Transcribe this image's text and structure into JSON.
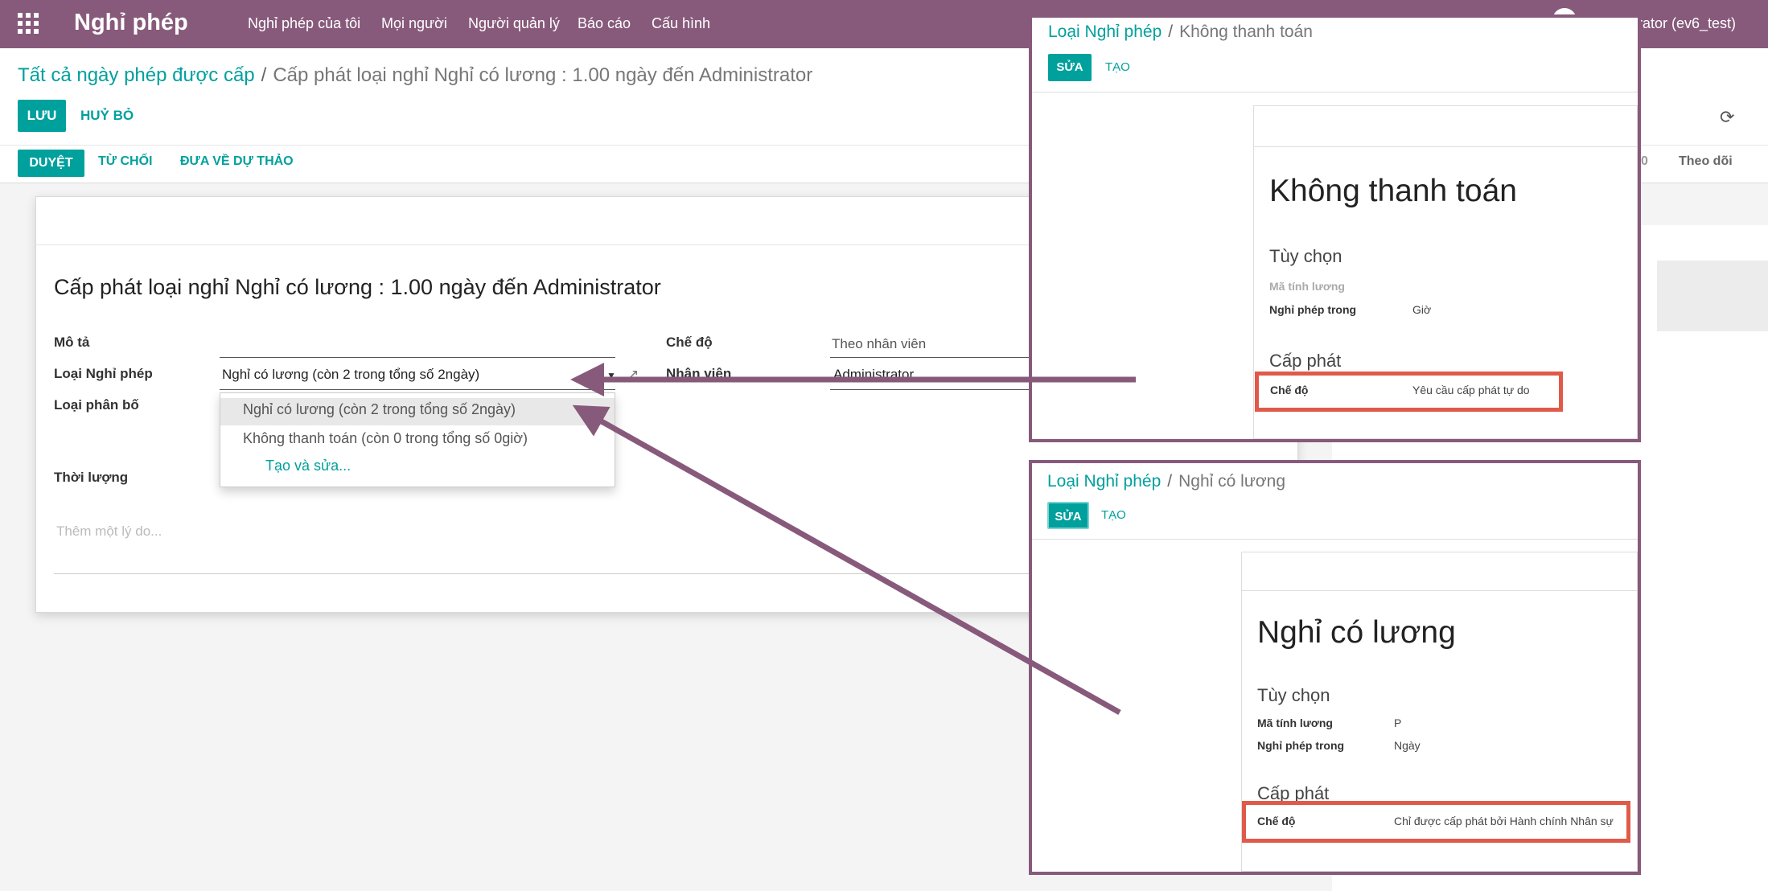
{
  "navbar": {
    "brand": "Nghỉ phép",
    "menu": [
      "Nghỉ phép của tôi",
      "Mọi người",
      "Người quản lý",
      "Báo cáo",
      "Cấu hình"
    ],
    "user": "rator (ev6_test)"
  },
  "control_panel": {
    "breadcrumb_parent": "Tất cả ngày phép được cấp",
    "breadcrumb_separator": "/",
    "breadcrumb_current": "Cấp phát loại nghỉ Nghỉ có lương : 1.00 ngày đến Administrator",
    "save_label": "LƯU",
    "discard_label": "HUỶ BỎ",
    "status_buttons": {
      "approve": "DUYỆT",
      "refuse": "TỪ CHỐI",
      "draft": "ĐƯA VỀ DỰ THẢO"
    },
    "follower_count": "0",
    "follow_label": "Theo dõi"
  },
  "form": {
    "title": "Cấp phát loại nghỉ Nghỉ có lương : 1.00 ngày đến Administrator",
    "fields": {
      "description_label": "Mô tả",
      "leave_type_label": "Loại Nghỉ phép",
      "leave_type_value": "Nghỉ có lương (còn 2 trong tổng số 2ngày)",
      "allocation_type_label": "Loại phân bố",
      "duration_label": "Thời lượng",
      "mode_label": "Chế độ",
      "mode_value": "Theo nhân viên",
      "employee_label": "Nhân viên",
      "employee_value": "Administrator"
    },
    "reason_placeholder": "Thêm một lý do..."
  },
  "dropdown": {
    "options": [
      "Nghỉ có lương (còn 2 trong tổng số 2ngày)",
      "Không thanh toán (còn 0 trong tổng số 0giờ)"
    ],
    "create_edit": "Tạo và sửa..."
  },
  "overlay_top": {
    "breadcrumb_parent": "Loại Nghỉ phép",
    "breadcrumb_current": "Không thanh toán",
    "edit_label": "SỬA",
    "create_label": "TẠO",
    "title": "Không thanh toán",
    "options_section": "Tùy chọn",
    "payroll_code_label": "Mã tính lương",
    "leave_in_label": "Nghỉ phép trong",
    "leave_in_value": "Giờ",
    "allocation_section": "Cấp phát",
    "mode_label": "Chế độ",
    "mode_value": "Yêu cầu cấp phát tự do"
  },
  "overlay_bottom": {
    "breadcrumb_parent": "Loại Nghỉ phép",
    "breadcrumb_current": "Nghỉ có lương",
    "edit_label": "SỬA",
    "create_label": "TẠO",
    "title": "Nghỉ có lương",
    "options_section": "Tùy chọn",
    "payroll_code_label": "Mã tính lương",
    "payroll_code_value": "P",
    "leave_in_label": "Nghỉ phép trong",
    "leave_in_value": "Ngày",
    "allocation_section": "Cấp phát",
    "mode_label": "Chế độ",
    "mode_value": "Chỉ được cấp phát bởi Hành chính Nhân sự"
  },
  "colors": {
    "brand_purple": "#875a7b",
    "accent_teal": "#00a09d",
    "highlight_red": "#e05a4a"
  }
}
